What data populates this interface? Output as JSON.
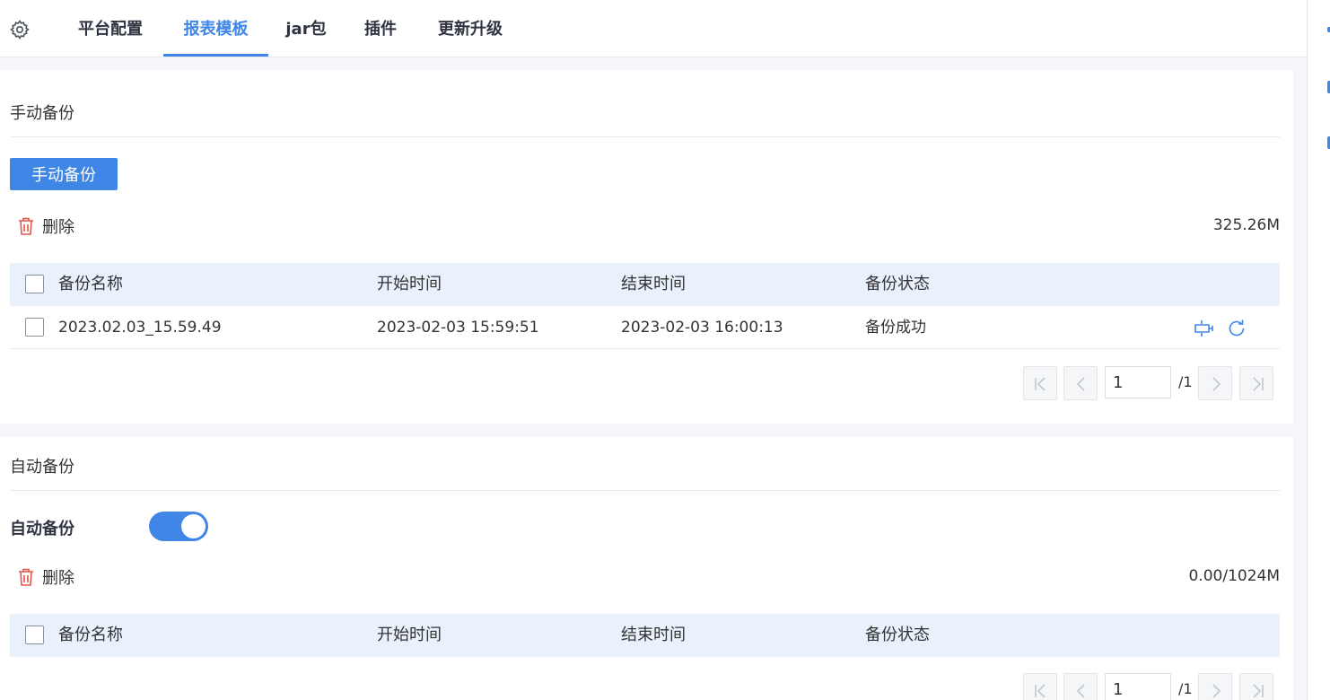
{
  "tabs": [
    {
      "label": "平台配置",
      "active": false
    },
    {
      "label": "报表模板",
      "active": true
    },
    {
      "label": "jar包",
      "active": false
    },
    {
      "label": "插件",
      "active": false
    },
    {
      "label": "更新升级",
      "active": false
    }
  ],
  "manual": {
    "title": "手动备份",
    "button_label": "手动备份",
    "delete_label": "删除",
    "usage": "325.26M",
    "columns": [
      "备份名称",
      "开始时间",
      "结束时间",
      "备份状态"
    ],
    "rows": [
      {
        "name": "2023.02.03_15.59.49",
        "start": "2023-02-03 15:59:51",
        "end": "2023-02-03 16:00:13",
        "status": "备份成功"
      }
    ],
    "pager": {
      "page": "1",
      "total": "/1"
    }
  },
  "auto": {
    "title": "自动备份",
    "switch_label": "自动备份",
    "switch_on": true,
    "delete_label": "删除",
    "usage": "0.00/1024M",
    "columns": [
      "备份名称",
      "开始时间",
      "结束时间",
      "备份状态"
    ],
    "pager": {
      "page": "1",
      "total": "/1"
    }
  },
  "colors": {
    "accent": "#3f86e6",
    "header_bg": "#e9f1fc",
    "danger": "#e0554b"
  },
  "icons": [
    "gear-icon",
    "trash-icon",
    "restore-icon",
    "refresh-icon",
    "first-page-icon",
    "prev-page-icon",
    "next-page-icon",
    "last-page-icon"
  ]
}
